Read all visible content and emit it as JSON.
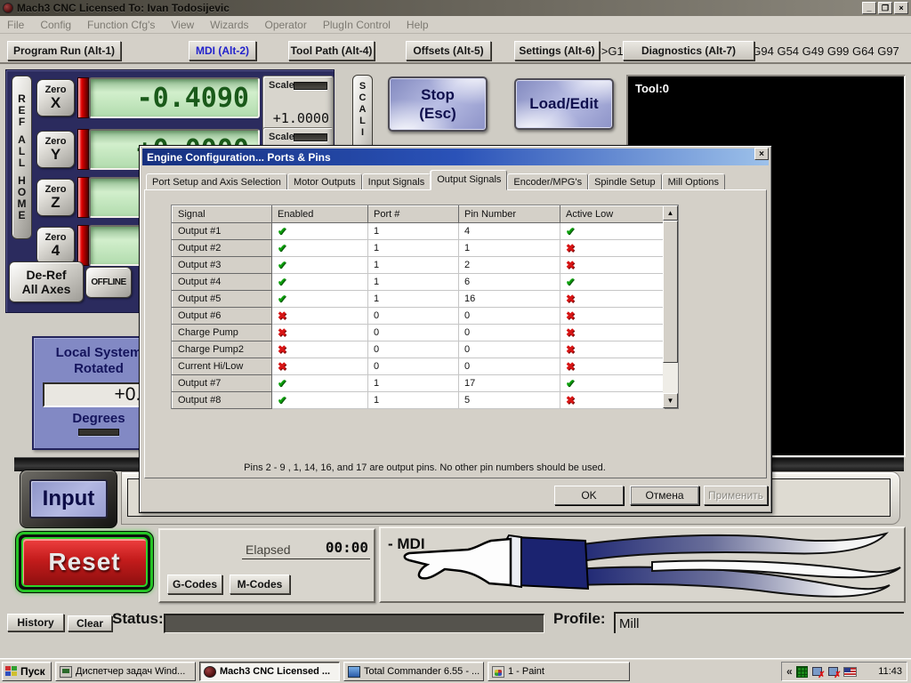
{
  "window": {
    "title": "Mach3 CNC  Licensed To: Ivan Todosijevic",
    "controls": {
      "minimize": "_",
      "maximize": "❐",
      "close": "×"
    }
  },
  "menu": {
    "items": [
      "File",
      "Config",
      "Function Cfg's",
      "View",
      "Wizards",
      "Operator",
      "PlugIn Control",
      "Help"
    ]
  },
  "screen_tabs": {
    "items": [
      {
        "label": "Program Run (Alt-1)",
        "active": false
      },
      {
        "label": "MDI (Alt-2)",
        "active": true
      },
      {
        "label": "Tool Path (Alt-4)",
        "active": false
      },
      {
        "label": "Offsets (Alt-5)",
        "active": false
      },
      {
        "label": "Settings (Alt-6)",
        "active": false
      },
      {
        "label": "Diagnostics (Alt-7)",
        "active": false
      }
    ],
    "gcode_status": "Mill->G15  G0 G17 G40 G21 G90 G94 G54 G49 G99 G64 G97"
  },
  "dro_panel": {
    "ref_button": "REF ALL HOME",
    "zero_label": "Zero",
    "axes": [
      {
        "axis": "X",
        "value": "-0.4090",
        "scale_label": "Scale",
        "scale_value": "+1.0000"
      },
      {
        "axis": "Y",
        "value": "+0.0000",
        "scale_label": "Scale",
        "scale_value": ""
      },
      {
        "axis": "Z",
        "value": "",
        "scale_label": "",
        "scale_value": ""
      },
      {
        "axis": "4",
        "value": "",
        "scale_label": "",
        "scale_value": ""
      }
    ],
    "deref_line1": "De-Ref",
    "deref_line2": "All Axes",
    "offline_button": "OFFLINE"
  },
  "local_system": {
    "title_line1": "Local System",
    "title_line2": "Rotated",
    "value": "+0.0",
    "unit": "Degrees"
  },
  "top_buttons": {
    "scale_strip": "SCALI",
    "stop_line1": "Stop",
    "stop_line2": "(Esc)",
    "load_edit": "Load/Edit"
  },
  "toolpath": {
    "tool_label": "Tool:0"
  },
  "mdi_section": {
    "input_button": "Input",
    "mode_label": "- MDI"
  },
  "control_bar": {
    "reset_button": "Reset",
    "elapsed_label": "Elapsed",
    "elapsed_value": "00:00",
    "gcodes_button": "G-Codes",
    "mcodes_button": "M-Codes"
  },
  "status_bar": {
    "history_button": "History",
    "clear_button": "Clear",
    "status_label": "Status:",
    "profile_label": "Profile:",
    "profile_value": "Mill"
  },
  "dialog": {
    "title": "Engine Configuration... Ports & Pins",
    "close": "×",
    "tabs": [
      {
        "label": "Port Setup and Axis Selection",
        "active": false
      },
      {
        "label": "Motor Outputs",
        "active": false
      },
      {
        "label": "Input Signals",
        "active": false
      },
      {
        "label": "Output Signals",
        "active": true
      },
      {
        "label": "Encoder/MPG's",
        "active": false
      },
      {
        "label": "Spindle Setup",
        "active": false
      },
      {
        "label": "Mill Options",
        "active": false
      }
    ],
    "table": {
      "columns": [
        "Signal",
        "Enabled",
        "Port #",
        "Pin Number",
        "Active Low"
      ],
      "rows": [
        {
          "signal": "Output #1",
          "enabled": true,
          "port": "1",
          "pin": "4",
          "active_low": true
        },
        {
          "signal": "Output #2",
          "enabled": true,
          "port": "1",
          "pin": "1",
          "active_low": false
        },
        {
          "signal": "Output #3",
          "enabled": true,
          "port": "1",
          "pin": "2",
          "active_low": false
        },
        {
          "signal": "Output #4",
          "enabled": true,
          "port": "1",
          "pin": "6",
          "active_low": true
        },
        {
          "signal": "Output #5",
          "enabled": true,
          "port": "1",
          "pin": "16",
          "active_low": false
        },
        {
          "signal": "Output #6",
          "enabled": false,
          "port": "0",
          "pin": "0",
          "active_low": false
        },
        {
          "signal": "Charge Pump",
          "enabled": false,
          "port": "0",
          "pin": "0",
          "active_low": false
        },
        {
          "signal": "Charge Pump2",
          "enabled": false,
          "port": "0",
          "pin": "0",
          "active_low": false
        },
        {
          "signal": "Current Hi/Low",
          "enabled": false,
          "port": "0",
          "pin": "0",
          "active_low": false
        },
        {
          "signal": "Output #7",
          "enabled": true,
          "port": "1",
          "pin": "17",
          "active_low": true
        },
        {
          "signal": "Output #8",
          "enabled": true,
          "port": "1",
          "pin": "5",
          "active_low": false
        }
      ],
      "check_glyph": "✔",
      "cross_glyph": "✖",
      "check_color": "#0ca00c",
      "cross_color": "#d81414"
    },
    "note": "Pins 2 - 9 , 1, 14, 16, and 17 are output pins. No  other pin numbers should be used.",
    "buttons": {
      "ok": "OK",
      "cancel": "Отмена",
      "apply": "Применить"
    }
  },
  "taskbar": {
    "start_button": "Пуск",
    "tasks": [
      {
        "label": "Диспетчер задач Wind...",
        "icon": "taskmgr",
        "active": false
      },
      {
        "label": "Mach3 CNC  Licensed ...",
        "icon": "mach3",
        "active": true
      },
      {
        "label": "Total Commander 6.55 - ...",
        "icon": "tc",
        "active": false
      },
      {
        "label": "1 - Paint",
        "icon": "paint",
        "active": false
      }
    ],
    "tray": {
      "overflow": "«",
      "time": "11:43"
    }
  }
}
